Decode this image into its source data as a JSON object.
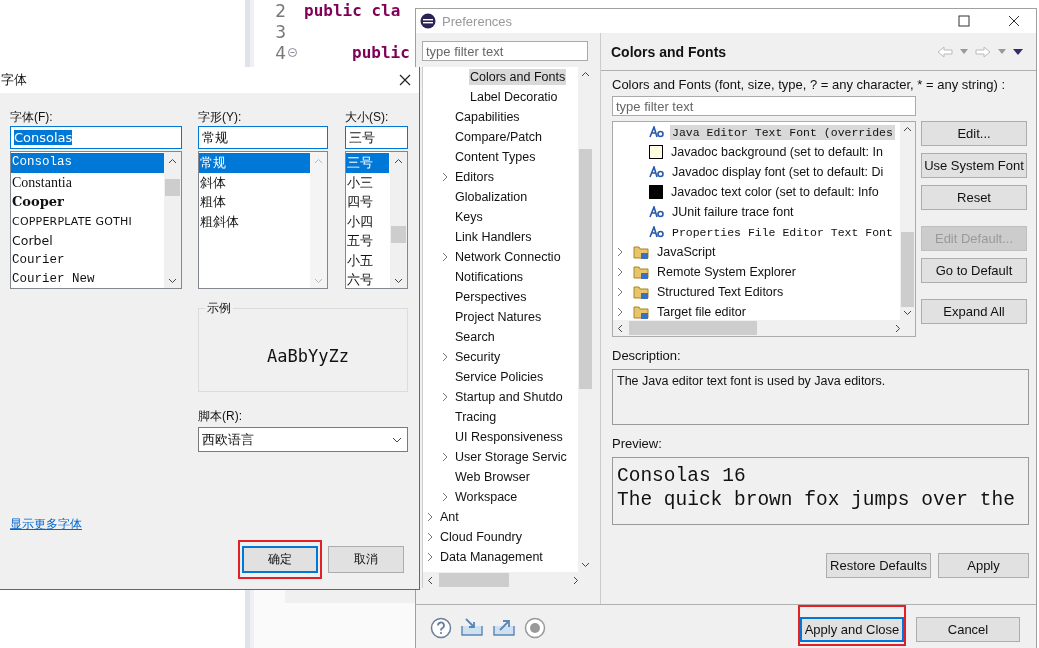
{
  "editor": {
    "lines": [
      {
        "number": "2",
        "tokens": [
          {
            "text": "public cla",
            "kind": "keyword"
          }
        ]
      },
      {
        "number": "3"
      },
      {
        "number": "4",
        "foldable": true,
        "tokens": [
          {
            "text": "public",
            "kind": "keyword"
          }
        ]
      }
    ]
  },
  "font_dialog": {
    "title": "字体",
    "font": {
      "label": "字体(F):",
      "value": "Consolas",
      "items": [
        {
          "label": "Consolas",
          "kind": "mono",
          "selected": true
        },
        {
          "label": "Constantia",
          "kind": "serif",
          "selected": false
        },
        {
          "label": "Cooper",
          "kind": "heavy",
          "selected": false
        },
        {
          "label": "COPPERPLATE GOTHI",
          "kind": "wide",
          "selected": false
        },
        {
          "label": "Corbel",
          "kind": "sans",
          "selected": false
        },
        {
          "label": "Courier",
          "kind": "mono",
          "selected": false
        },
        {
          "label": "Courier New",
          "kind": "mono",
          "selected": false
        }
      ]
    },
    "style": {
      "label": "字形(Y):",
      "value": "常规",
      "items": [
        {
          "label": "常规",
          "selected": true
        },
        {
          "label": "斜体",
          "selected": false
        },
        {
          "label": "粗体",
          "selected": false
        },
        {
          "label": "粗斜体",
          "selected": false
        }
      ]
    },
    "size": {
      "label": "大小(S):",
      "value": "三号",
      "items": [
        {
          "label": "三号",
          "selected": true
        },
        {
          "label": "小三",
          "selected": false
        },
        {
          "label": "四号",
          "selected": false
        },
        {
          "label": "小四",
          "selected": false
        },
        {
          "label": "五号",
          "selected": false
        },
        {
          "label": "小五",
          "selected": false
        },
        {
          "label": "六号",
          "selected": false
        }
      ]
    },
    "sample": {
      "legend": "示例",
      "text": "AaBbYyZz"
    },
    "script": {
      "label": "脚本(R):",
      "value": "西欧语言"
    },
    "link": "显示更多字体",
    "buttons": [
      {
        "label": "确定",
        "default": true,
        "highlighted": true
      },
      {
        "label": "取消",
        "default": false,
        "highlighted": false
      }
    ]
  },
  "preferences": {
    "title": "Preferences",
    "filter_placeholder": "type filter text",
    "tree": [
      {
        "children": [
          {
            "children": [
              {
                "label": "Colors and Fonts",
                "expandable": false,
                "selected": true
              },
              {
                "label": "Label Decoratio",
                "expandable": false,
                "selected": false
              }
            ]
          },
          {
            "label": "Capabilities",
            "expandable": false,
            "selected": false
          },
          {
            "label": "Compare/Patch",
            "expandable": false,
            "selected": false
          },
          {
            "label": "Content Types",
            "expandable": false,
            "selected": false
          },
          {
            "label": "Editors",
            "expandable": true,
            "selected": false
          },
          {
            "label": "Globalization",
            "expandable": false,
            "selected": false
          },
          {
            "label": "Keys",
            "expandable": false,
            "selected": false
          },
          {
            "label": "Link Handlers",
            "expandable": false,
            "selected": false
          },
          {
            "label": "Network Connectio",
            "expandable": true,
            "selected": false
          },
          {
            "label": "Notifications",
            "expandable": false,
            "selected": false
          },
          {
            "label": "Perspectives",
            "expandable": false,
            "selected": false
          },
          {
            "label": "Project Natures",
            "expandable": false,
            "selected": false
          },
          {
            "label": "Search",
            "expandable": false,
            "selected": false
          },
          {
            "label": "Security",
            "expandable": true,
            "selected": false
          },
          {
            "label": "Service Policies",
            "expandable": false,
            "selected": false
          },
          {
            "label": "Startup and Shutdo",
            "expandable": true,
            "selected": false
          },
          {
            "label": "Tracing",
            "expandable": false,
            "selected": false
          },
          {
            "label": "UI Responsiveness",
            "expandable": false,
            "selected": false
          },
          {
            "label": "User Storage Servic",
            "expandable": true,
            "selected": false
          },
          {
            "label": "Web Browser",
            "expandable": false,
            "selected": false
          },
          {
            "label": "Workspace",
            "expandable": true,
            "selected": false
          }
        ]
      },
      {
        "label": "Ant",
        "expandable": true,
        "selected": false
      },
      {
        "label": "Cloud Foundry",
        "expandable": true,
        "selected": false
      },
      {
        "label": "Data Management",
        "expandable": true,
        "selected": false
      }
    ],
    "page": {
      "title": "Colors and Fonts",
      "intro": "Colors and Fonts (font, size, type, ? = any character, * = any string) :",
      "filter_placeholder": "type filter text",
      "tree": [
        {
          "children": [
            {
              "label": "Java Editor Text Font (overrides",
              "kind": "mono-font",
              "selected": true
            },
            {
              "label": "Javadoc background (set to default: In",
              "kind": "color",
              "color": "#fffbe0",
              "selected": false
            },
            {
              "label": "Javadoc display font (set to default: Di",
              "kind": "font",
              "selected": false
            },
            {
              "label": "Javadoc text color (set to default: Info",
              "kind": "color",
              "color": "#000000",
              "selected": false
            },
            {
              "label": "JUnit failure trace font",
              "kind": "font",
              "selected": false
            },
            {
              "label": "Properties File Editor Text Font",
              "kind": "mono-font",
              "selected": false
            }
          ]
        },
        {
          "label": "JavaScript",
          "kind": "category",
          "selected": false
        },
        {
          "label": "Remote System Explorer",
          "kind": "category",
          "selected": false
        },
        {
          "label": "Structured Text Editors",
          "kind": "category",
          "selected": false
        },
        {
          "label": "Target file editor",
          "kind": "category",
          "selected": false
        }
      ],
      "side_buttons": [
        {
          "label": "Edit...",
          "disabled": false
        },
        {
          "label": "Use System Font",
          "disabled": false
        },
        {
          "label": "Reset",
          "disabled": false
        },
        {
          "label": "Edit Default...",
          "disabled": true
        },
        {
          "label": "Go to Default",
          "disabled": false
        },
        {
          "label": "Expand All",
          "disabled": false
        }
      ],
      "description_label": "Description:",
      "description": "The Java editor text font is used by Java editors.",
      "preview_label": "Preview:",
      "preview": [
        "Consolas 16",
        "The quick brown fox jumps over the"
      ],
      "buttons": [
        "Restore Defaults",
        "Apply"
      ]
    },
    "buttons": [
      {
        "label": "Apply and Close",
        "default": true,
        "highlighted": true
      },
      {
        "label": "Cancel",
        "default": false,
        "highlighted": false
      }
    ]
  }
}
